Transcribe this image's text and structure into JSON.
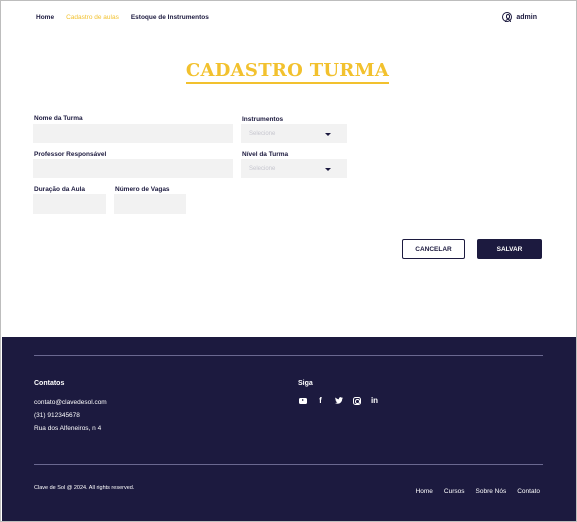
{
  "header": {
    "nav": [
      {
        "label": "Home"
      },
      {
        "label": "Cadastro de aulas"
      },
      {
        "label": "Estoque de Instrumentos"
      }
    ],
    "user": "admin"
  },
  "page_title": "CADASTRO TURMA",
  "form": {
    "nome_label": "Nome da Turma",
    "nome_value": "",
    "instrumentos_label": "Instrumentos",
    "instrumentos_value": "Selecione",
    "professor_label": "Professor Responsável",
    "professor_value": "",
    "nivel_label": "Nível da Turma",
    "nivel_value": "Selecione",
    "duracao_label": "Duração da Aula",
    "duracao_value": "",
    "vagas_label": "Número de Vagas",
    "vagas_value": ""
  },
  "actions": {
    "cancel": "CANCELAR",
    "save": "SALVAR"
  },
  "footer": {
    "contatos_heading": "Contatos",
    "email": "contato@clavedesol.com",
    "phone": "(31) 912345678",
    "address": "Rua dos Alfeneiros, n 4",
    "siga_heading": "Siga",
    "social_icons": [
      "youtube-icon",
      "facebook-icon",
      "twitter-icon",
      "instagram-icon",
      "linkedin-icon"
    ],
    "copyright": "Clave de Sol @ 2024. All rights reserved.",
    "nav": [
      "Home",
      "Cursos",
      "Sobre Nós",
      "Contato"
    ]
  },
  "colors": {
    "accent": "#f2c12e",
    "primary": "#1c1a3f",
    "field_bg": "#f2f2f2"
  }
}
